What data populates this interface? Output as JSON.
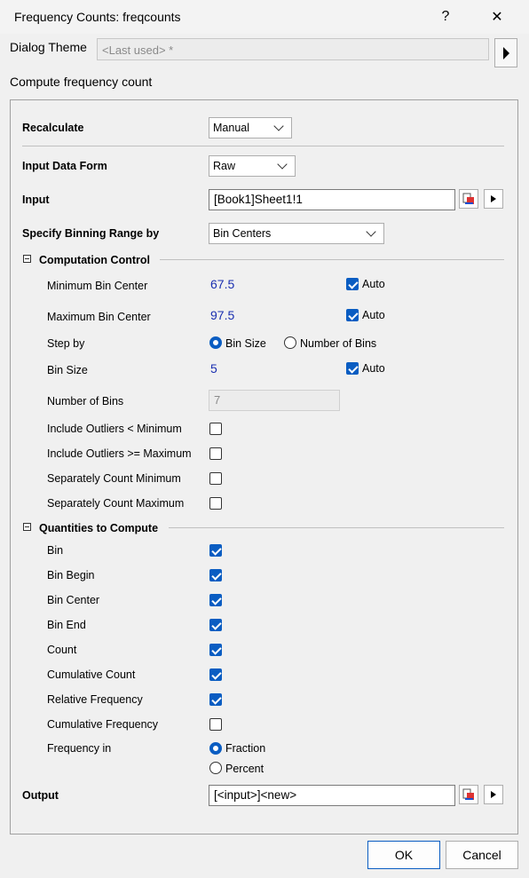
{
  "window": {
    "title": "Frequency Counts: freqcounts",
    "help_label": "?",
    "close_label": "✕"
  },
  "theme": {
    "label": "Dialog Theme",
    "value": "<Last used> *"
  },
  "description": "Compute frequency count",
  "recalculate": {
    "label": "Recalculate",
    "value": "Manual"
  },
  "input_form": {
    "label": "Input Data Form",
    "value": "Raw"
  },
  "input": {
    "label": "Input",
    "value": "[Book1]Sheet1!1"
  },
  "binning": {
    "label": "Specify Binning Range by",
    "value": "Bin Centers"
  },
  "computation": {
    "title": "Computation Control",
    "min_center": {
      "label": "Minimum Bin Center",
      "value": "67.5",
      "auto_label": "Auto",
      "auto": true
    },
    "max_center": {
      "label": "Maximum Bin Center",
      "value": "97.5",
      "auto_label": "Auto",
      "auto": true
    },
    "step_by": {
      "label": "Step by",
      "option1": "Bin Size",
      "option2": "Number of Bins",
      "selected": "Bin Size"
    },
    "bin_size": {
      "label": "Bin Size",
      "value": "5",
      "auto_label": "Auto",
      "auto": true
    },
    "num_bins": {
      "label": "Number of Bins",
      "value": "7"
    },
    "outliers_min": {
      "label": "Include Outliers < Minimum",
      "checked": false
    },
    "outliers_max": {
      "label": "Include Outliers >= Maximum",
      "checked": false
    },
    "count_min": {
      "label": "Separately Count Minimum",
      "checked": false
    },
    "count_max": {
      "label": "Separately Count Maximum",
      "checked": false
    }
  },
  "quantities": {
    "title": "Quantities to Compute",
    "items": [
      {
        "label": "Bin",
        "checked": true
      },
      {
        "label": "Bin Begin",
        "checked": true
      },
      {
        "label": "Bin Center",
        "checked": true
      },
      {
        "label": "Bin End",
        "checked": true
      },
      {
        "label": "Count",
        "checked": true
      },
      {
        "label": "Cumulative Count",
        "checked": true
      },
      {
        "label": "Relative Frequency",
        "checked": true
      },
      {
        "label": "Cumulative Frequency",
        "checked": false
      }
    ],
    "frequency_in": {
      "label": "Frequency in",
      "option1": "Fraction",
      "option2": "Percent",
      "selected": "Fraction"
    }
  },
  "output": {
    "label": "Output",
    "value": "[<input>]<new>"
  },
  "buttons": {
    "ok": "OK",
    "cancel": "Cancel"
  },
  "colors": {
    "accent": "#0a5dc2",
    "value_text": "#1a2fb0"
  }
}
